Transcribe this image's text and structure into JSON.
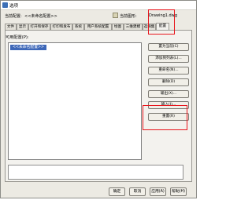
{
  "window": {
    "title": "选项"
  },
  "info": {
    "current_profile_label": "当前配置:",
    "current_profile_value": "<<未命名配置>>",
    "current_drawing_label": "当前图形:",
    "current_drawing_value": "Drawing1.dwg"
  },
  "tabs": [
    {
      "label": "文件"
    },
    {
      "label": "显示"
    },
    {
      "label": "打开和保存"
    },
    {
      "label": "打印和发布"
    },
    {
      "label": "系统"
    },
    {
      "label": "用户系统配置"
    },
    {
      "label": "绘图"
    },
    {
      "label": "三维建模"
    },
    {
      "label": "选择集"
    },
    {
      "label": "配置",
      "active": true
    }
  ],
  "profiles": {
    "label": "可用配置(P):",
    "items": [
      "<<未命名配置>>"
    ]
  },
  "side_buttons": [
    {
      "label": "置为当前(C)"
    },
    {
      "label": "添加到列表(L)..."
    },
    {
      "label": "重命名(N)..."
    },
    {
      "label": "删除(D)"
    },
    {
      "label": "输出(X)..."
    },
    {
      "label": "输入(I)..."
    },
    {
      "label": "重置(R)"
    }
  ],
  "footer": {
    "ok": "确定",
    "cancel": "取消",
    "apply": "应用(A)",
    "help": "帮助(H)"
  },
  "colors": {
    "highlight_red": "#e8141b",
    "selection_blue": "#3d67b8"
  }
}
